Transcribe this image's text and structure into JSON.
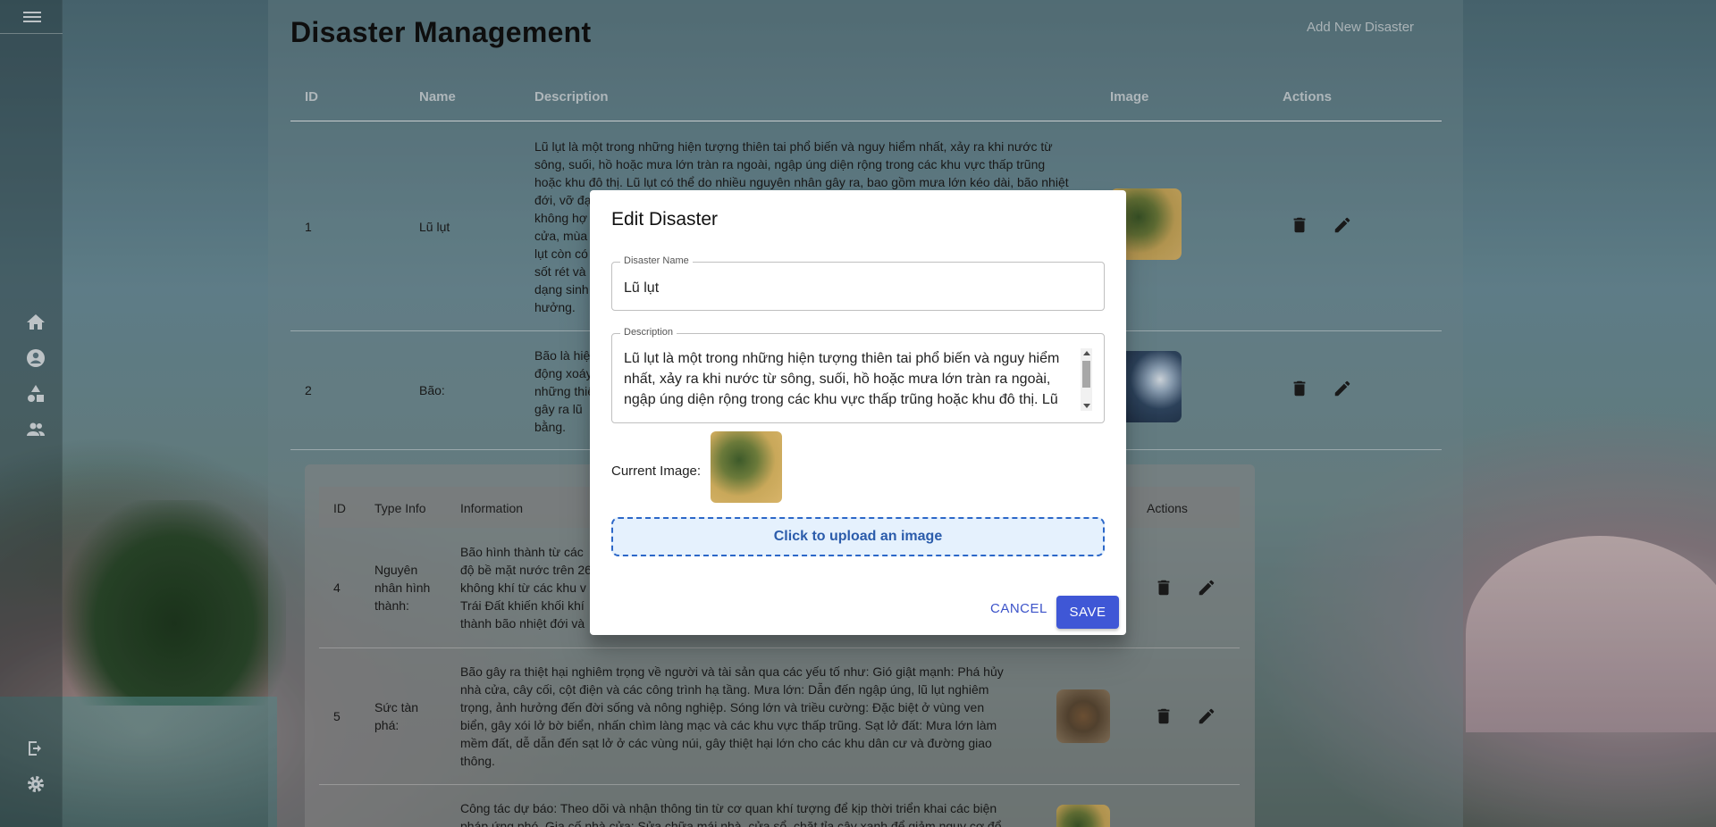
{
  "page": {
    "title": "Disaster Management",
    "add_link": "Add New Disaster"
  },
  "table": {
    "headers": [
      "ID",
      "Name",
      "Description",
      "Image",
      "Actions"
    ],
    "rows": [
      {
        "id": "1",
        "name": "Lũ lụt",
        "description_lines": [
          "Lũ lụt là một trong những hiện tượng thiên tai phổ biến và nguy hiểm nhất, xảy ra khi nước từ",
          "sông, suối, hồ hoặc mưa lớn tràn ra ngoài, ngập úng diện rộng trong các khu vực thấp trũng",
          "hoặc khu đô thị. Lũ lụt có thể do nhiều nguyên nhân gây ra, bao gồm mưa lớn kéo dài, bão nhiệt",
          "đới, vỡ đạ",
          "không hợ",
          "cửa, mùa",
          "lụt còn có",
          "sốt rét và",
          "dạng sinh",
          "hưởng."
        ]
      },
      {
        "id": "2",
        "name": "Bão:",
        "description_lines": [
          "Bão là hiệ",
          "động xoáy",
          "những thiệ",
          "gây ra lũ",
          "bằng."
        ]
      }
    ]
  },
  "subtable": {
    "headers": [
      "ID",
      "Type Info",
      "Information",
      "Actions"
    ],
    "rows": [
      {
        "id": "4",
        "type_lines": [
          "Nguyên",
          "nhân hình",
          "thành:"
        ],
        "info_lines": [
          "Bão hình thành từ các",
          "độ bề mặt nước trên 26",
          "không khí từ các khu v",
          "Trái Đất khiến khối khí",
          "thành bão nhiệt đới và"
        ]
      },
      {
        "id": "5",
        "type_lines": [
          "Sức tàn",
          "phá:"
        ],
        "info_lines": [
          "Bão gây ra thiệt hại nghiêm trọng về người và tài sản qua các yếu tố như: Gió giật mạnh: Phá hủy",
          "nhà cửa, cây cối, cột điện và các công trình hạ tầng. Mưa lớn: Dẫn đến ngập úng, lũ lụt nghiêm",
          "trọng, ảnh hưởng đến đời sống và nông nghiệp. Sóng lớn và triều cường: Đặc biệt ở vùng ven",
          "biển, gây xói lở bờ biển, nhấn chìm làng mạc và các khu vực thấp trũng. Sạt lở đất: Mưa lớn làm",
          "mềm đất, dễ dẫn đến sạt lở ở các vùng núi, gây thiệt hại lớn cho các khu dân cư và đường giao",
          "thông."
        ]
      },
      {
        "id": "",
        "type_lines": [],
        "info_lines": [
          "Công tác dự báo: Theo dõi và nhận thông tin từ cơ quan khí tượng để kịp thời triển khai các biện",
          "pháp ứng phó. Gia cố nhà cửa: Sửa chữa mái nhà, cửa sổ, chặt tỉa cây xanh để giảm nguy cơ đổ"
        ]
      }
    ]
  },
  "dialog": {
    "title": "Edit Disaster",
    "name_label": "Disaster Name",
    "name_value": "Lũ lụt",
    "desc_label": "Description",
    "desc_lines": [
      "Lũ lụt là một trong những hiện tượng thiên tai phổ biến và nguy hiểm",
      "nhất, xảy ra khi nước từ sông, suối, hồ hoặc mưa lớn tràn ra ngoài,",
      "ngập úng diện rộng trong các khu vực thấp trũng hoặc khu đô thị. Lũ"
    ],
    "current_image_label": "Current Image:",
    "upload_label": "Click to upload an image",
    "cancel_label": "CANCEL",
    "save_label": "SAVE"
  },
  "colors": {
    "primary": "#3f57d6",
    "upload_border": "#2b67c8",
    "upload_bg": "#e5f1fd"
  }
}
